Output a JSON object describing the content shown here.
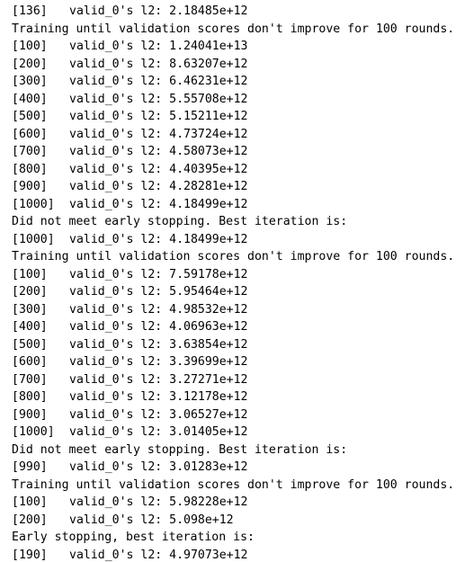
{
  "log": {
    "lines": [
      {
        "kind": "entry",
        "iter": "[136]",
        "text": "valid_0's l2: 2.18485e+12"
      },
      {
        "kind": "message",
        "text": "Training until validation scores don't improve for 100 rounds."
      },
      {
        "kind": "entry",
        "iter": "[100]",
        "text": "valid_0's l2: 1.24041e+13"
      },
      {
        "kind": "entry",
        "iter": "[200]",
        "text": "valid_0's l2: 8.63207e+12"
      },
      {
        "kind": "entry",
        "iter": "[300]",
        "text": "valid_0's l2: 6.46231e+12"
      },
      {
        "kind": "entry",
        "iter": "[400]",
        "text": "valid_0's l2: 5.55708e+12"
      },
      {
        "kind": "entry",
        "iter": "[500]",
        "text": "valid_0's l2: 5.15211e+12"
      },
      {
        "kind": "entry",
        "iter": "[600]",
        "text": "valid_0's l2: 4.73724e+12"
      },
      {
        "kind": "entry",
        "iter": "[700]",
        "text": "valid_0's l2: 4.58073e+12"
      },
      {
        "kind": "entry",
        "iter": "[800]",
        "text": "valid_0's l2: 4.40395e+12"
      },
      {
        "kind": "entry",
        "iter": "[900]",
        "text": "valid_0's l2: 4.28281e+12"
      },
      {
        "kind": "entry",
        "iter": "[1000]",
        "text": "valid_0's l2: 4.18499e+12"
      },
      {
        "kind": "message",
        "text": "Did not meet early stopping. Best iteration is:"
      },
      {
        "kind": "entry",
        "iter": "[1000]",
        "text": "valid_0's l2: 4.18499e+12"
      },
      {
        "kind": "message",
        "text": "Training until validation scores don't improve for 100 rounds."
      },
      {
        "kind": "entry",
        "iter": "[100]",
        "text": "valid_0's l2: 7.59178e+12"
      },
      {
        "kind": "entry",
        "iter": "[200]",
        "text": "valid_0's l2: 5.95464e+12"
      },
      {
        "kind": "entry",
        "iter": "[300]",
        "text": "valid_0's l2: 4.98532e+12"
      },
      {
        "kind": "entry",
        "iter": "[400]",
        "text": "valid_0's l2: 4.06963e+12"
      },
      {
        "kind": "entry",
        "iter": "[500]",
        "text": "valid_0's l2: 3.63854e+12"
      },
      {
        "kind": "entry",
        "iter": "[600]",
        "text": "valid_0's l2: 3.39699e+12"
      },
      {
        "kind": "entry",
        "iter": "[700]",
        "text": "valid_0's l2: 3.27271e+12"
      },
      {
        "kind": "entry",
        "iter": "[800]",
        "text": "valid_0's l2: 3.12178e+12"
      },
      {
        "kind": "entry",
        "iter": "[900]",
        "text": "valid_0's l2: 3.06527e+12"
      },
      {
        "kind": "entry",
        "iter": "[1000]",
        "text": "valid_0's l2: 3.01405e+12"
      },
      {
        "kind": "message",
        "text": "Did not meet early stopping. Best iteration is:"
      },
      {
        "kind": "entry",
        "iter": "[990]",
        "text": "valid_0's l2: 3.01283e+12"
      },
      {
        "kind": "message",
        "text": "Training until validation scores don't improve for 100 rounds."
      },
      {
        "kind": "entry",
        "iter": "[100]",
        "text": "valid_0's l2: 5.98228e+12"
      },
      {
        "kind": "entry",
        "iter": "[200]",
        "text": "valid_0's l2: 5.098e+12"
      },
      {
        "kind": "message",
        "text": "Early stopping, best iteration is:"
      },
      {
        "kind": "entry",
        "iter": "[190]",
        "text": "valid_0's l2: 4.97073e+12"
      }
    ]
  }
}
